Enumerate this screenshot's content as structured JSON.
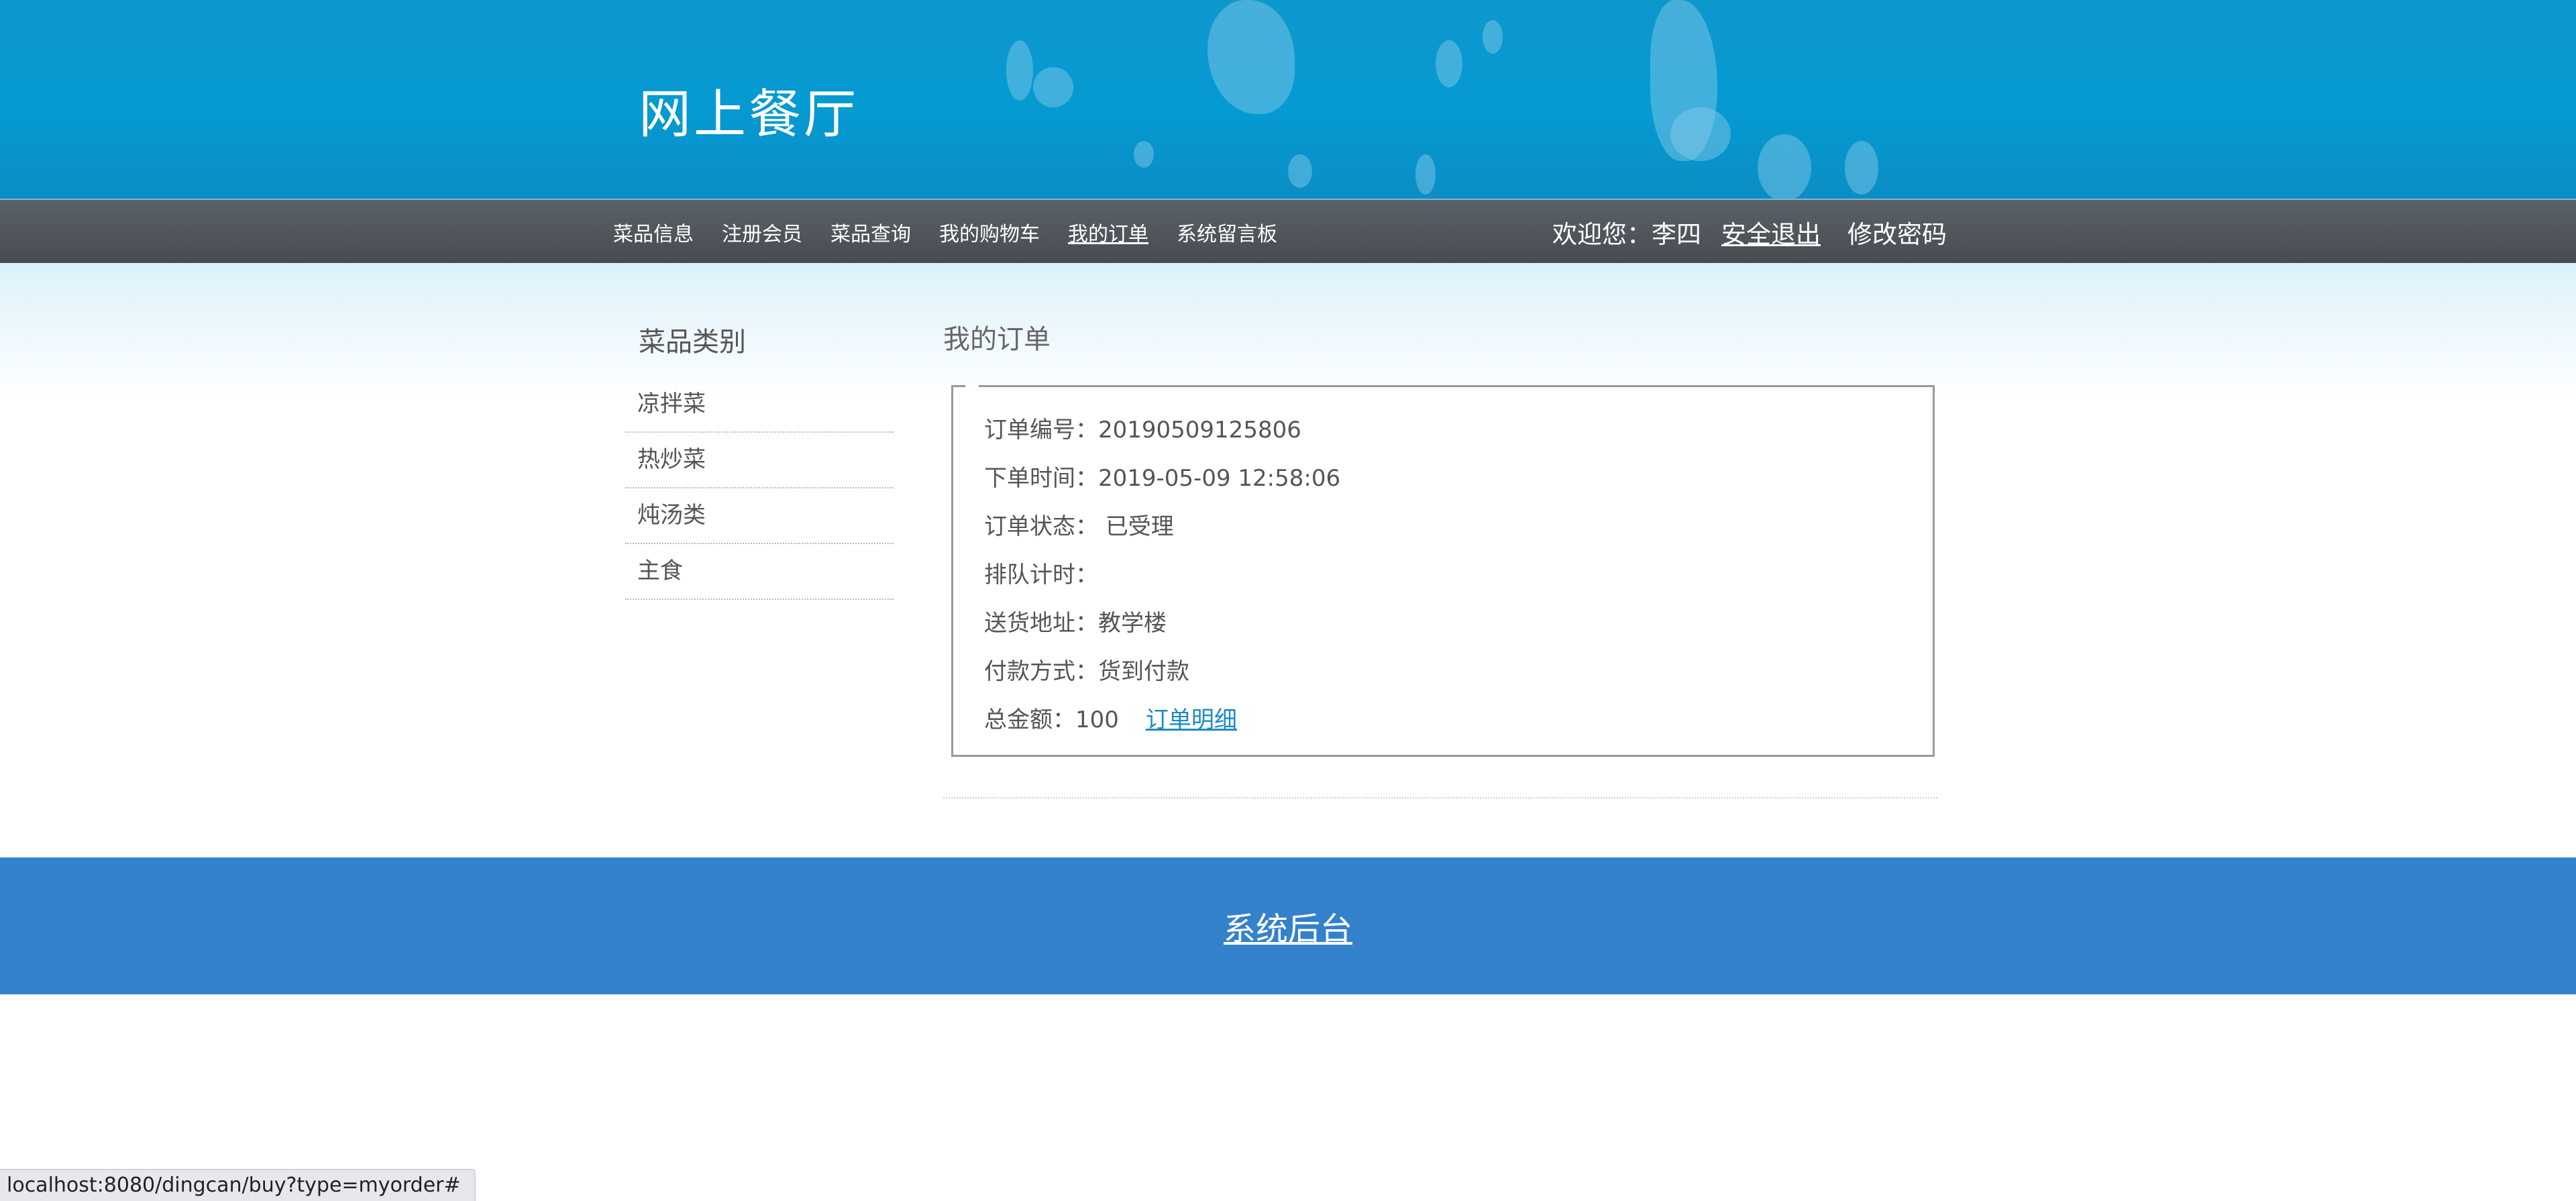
{
  "header": {
    "site_title": "网上餐厅"
  },
  "nav": {
    "links": [
      {
        "label": "菜品信息",
        "active": false
      },
      {
        "label": "注册会员",
        "active": false
      },
      {
        "label": "菜品查询",
        "active": false
      },
      {
        "label": "我的购物车",
        "active": false
      },
      {
        "label": "我的订单",
        "active": true
      },
      {
        "label": "系统留言板",
        "active": false
      }
    ],
    "greeting": "欢迎您：李四",
    "logout_label": "安全退出",
    "change_password_label": "修改密码"
  },
  "sidebar": {
    "title": "菜品类别",
    "categories": [
      "凉拌菜",
      "热炒菜",
      "炖汤类",
      "主食"
    ]
  },
  "main": {
    "title": "我的订单",
    "order": {
      "id_label": "订单编号：",
      "id_value": "20190509125806",
      "time_label": "下单时间：",
      "time_value": "2019-05-09 12:58:06",
      "status_label": "订单状态：",
      "status_value": "已受理",
      "queue_label": "排队计时：",
      "queue_value": "",
      "address_label": "送货地址：",
      "address_value": "教学楼",
      "payment_label": "付款方式：",
      "payment_value": "货到付款",
      "total_label": "总金额：",
      "total_value": "100",
      "detail_link": "订单明细"
    }
  },
  "footer": {
    "admin_link": "系统后台"
  },
  "statusbar": {
    "url": "localhost:8080/dingcan/buy?type=myorder#"
  },
  "colors": {
    "banner": "#059ad2",
    "navbar": "#4f555b",
    "footer": "#3481cc",
    "link": "#1a8bc7"
  }
}
